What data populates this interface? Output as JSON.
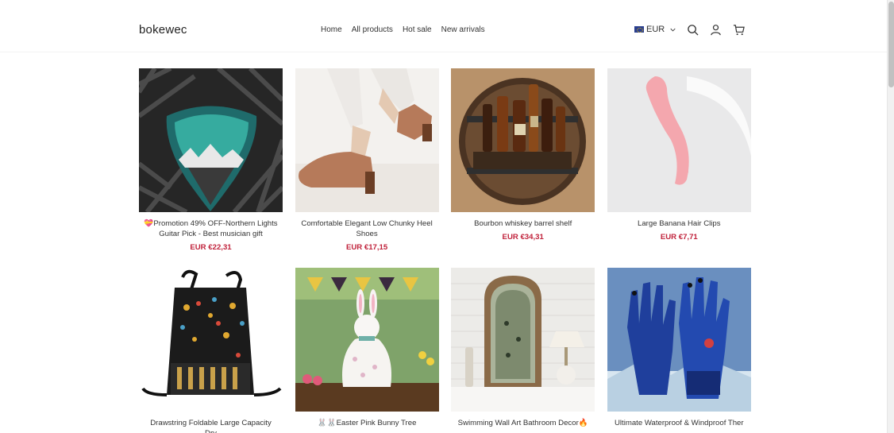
{
  "header": {
    "brand": "bokewec",
    "nav": [
      "Home",
      "All products",
      "Hot sale",
      "New arrivals"
    ],
    "currency": "EUR",
    "icons": [
      "search-icon",
      "account-icon",
      "cart-icon"
    ]
  },
  "products": [
    {
      "title": "💝Promotion 49% OFF-Northern Lights Guitar Pick - Best musician gift",
      "price": "EUR €22,31"
    },
    {
      "title": "Comfortable Elegant Low Chunky Heel Shoes",
      "price": "EUR €17,15"
    },
    {
      "title": "Bourbon whiskey barrel shelf",
      "price": "EUR €34,31"
    },
    {
      "title": "Large Banana Hair Clips",
      "price": "EUR €7,71"
    },
    {
      "title": "Drawstring Foldable Large Capacity Dry",
      "price": ""
    },
    {
      "title": "🐰🐰Easter Pink Bunny Tree",
      "price": ""
    },
    {
      "title": "Swimming Wall Art Bathroom Decor🔥",
      "price": ""
    },
    {
      "title": "Ultimate Waterproof & Windproof Ther",
      "price": ""
    }
  ],
  "colors": {
    "price": "#c0223b",
    "text": "#333333"
  }
}
